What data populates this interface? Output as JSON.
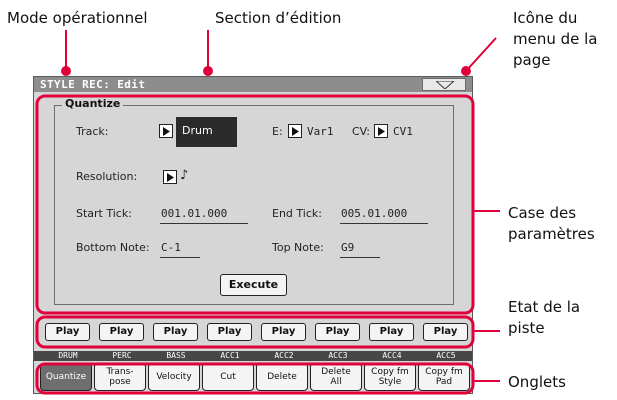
{
  "annotations": {
    "mode": "Mode opérationnel",
    "section": "Section d’édition",
    "menu_icon_l1": "Icône du",
    "menu_icon_l2": "menu de la",
    "menu_icon_l3": "page",
    "param_box_l1": "Case des",
    "param_box_l2": "paramètres",
    "track_state_l1": "Etat de la",
    "track_state_l2": "piste",
    "tabs": "Onglets"
  },
  "screen": {
    "title": "STYLE REC: Edit",
    "group_title": "Quantize",
    "track_label": "Track:",
    "track_value": "Drum",
    "e_label": "E:",
    "e_value": "Var1",
    "cv_label": "CV:",
    "cv_value": "CV1",
    "resolution_label": "Resolution:",
    "resolution_value": "♪",
    "start_tick_label": "Start Tick:",
    "start_tick_value": "001.01.000",
    "end_tick_label": "End Tick:",
    "end_tick_value": "005.01.000",
    "bottom_note_label": "Bottom Note:",
    "bottom_note_value": "C-1",
    "top_note_label": "Top Note:",
    "top_note_value": "G9",
    "execute_label": "Execute"
  },
  "play_buttons": [
    "Play",
    "Play",
    "Play",
    "Play",
    "Play",
    "Play",
    "Play",
    "Play"
  ],
  "tracks": [
    "DRUM",
    "PERC",
    "BASS",
    "ACC1",
    "ACC2",
    "ACC3",
    "ACC4",
    "ACC5"
  ],
  "tabs": [
    {
      "label": "Quantize",
      "selected": true
    },
    {
      "label": "Trans-\npose",
      "selected": false
    },
    {
      "label": "Velocity",
      "selected": false
    },
    {
      "label": "Cut",
      "selected": false
    },
    {
      "label": "Delete",
      "selected": false
    },
    {
      "label": "Delete\nAll",
      "selected": false
    },
    {
      "label": "Copy fm\nStyle",
      "selected": false
    },
    {
      "label": "Copy fm\nPad",
      "selected": false
    }
  ],
  "colors": {
    "highlight": "#e0003a",
    "screen_bg": "#d6d6d6",
    "titlebar": "#8d8d8d"
  }
}
